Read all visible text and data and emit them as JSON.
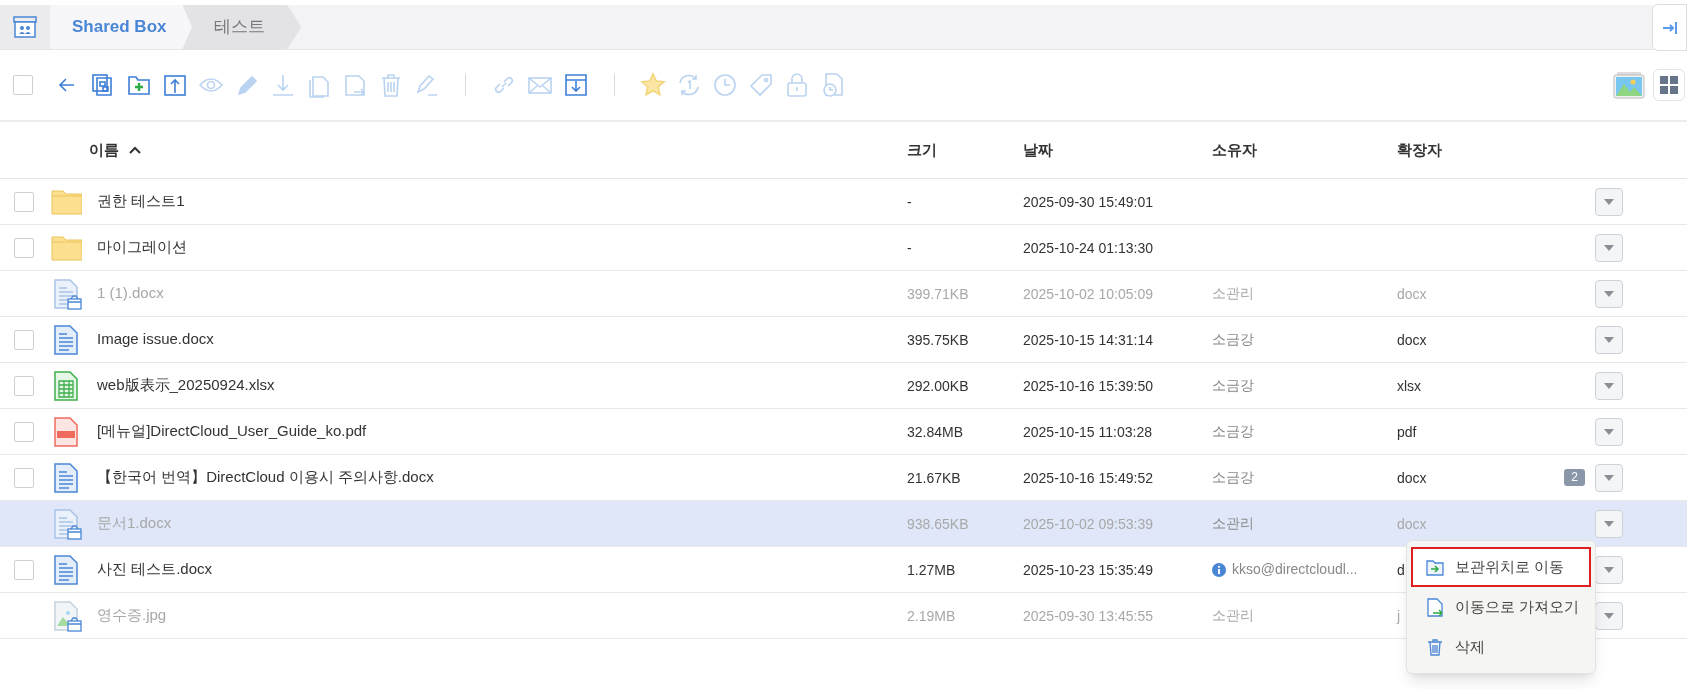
{
  "breadcrumb": [
    {
      "label": "Shared Box",
      "current": false
    },
    {
      "label": "테스트",
      "current": true
    }
  ],
  "toolbar": {
    "select_all": {
      "checked": false
    },
    "groups": [
      [
        {
          "kind": "back",
          "disabled": false
        },
        {
          "kind": "copy",
          "disabled": false
        },
        {
          "kind": "newfolder",
          "disabled": false
        },
        {
          "kind": "upload",
          "disabled": false
        },
        {
          "kind": "preview",
          "disabled": true
        },
        {
          "kind": "edit",
          "disabled": true
        },
        {
          "kind": "download",
          "disabled": true
        },
        {
          "kind": "duplicate",
          "disabled": true
        },
        {
          "kind": "move",
          "disabled": true
        },
        {
          "kind": "delete",
          "disabled": true
        },
        {
          "kind": "rename",
          "disabled": true
        }
      ],
      [
        {
          "kind": "link",
          "disabled": true
        },
        {
          "kind": "mail",
          "disabled": true
        },
        {
          "kind": "import",
          "disabled": false
        }
      ],
      [
        {
          "kind": "favorite",
          "disabled": true
        },
        {
          "kind": "sync",
          "disabled": true
        },
        {
          "kind": "history",
          "disabled": true
        },
        {
          "kind": "tag",
          "disabled": true
        },
        {
          "kind": "lock",
          "disabled": true
        },
        {
          "kind": "version",
          "disabled": true
        }
      ]
    ]
  },
  "table": {
    "columns": [
      {
        "label": "이름",
        "sort_ascending": true
      },
      {
        "label": "크기"
      },
      {
        "label": "날짜"
      },
      {
        "label": "소유자"
      },
      {
        "label": "확장자"
      }
    ],
    "rows": [
      {
        "kind": "folder",
        "name": "권한 테스트1",
        "size": "-",
        "date": "2025-09-30 15:49:01",
        "archived": false,
        "checked": false,
        "selected": false
      },
      {
        "kind": "folder",
        "name": "마이그레이션",
        "size": "-",
        "date": "2025-10-24 01:13:30",
        "archived": false,
        "checked": false,
        "selected": false
      },
      {
        "kind": "doc",
        "name": "1 (1).docx",
        "size": "399.71KB",
        "date": "2025-10-02 10:05:09",
        "owner": "소관리",
        "ext": "docx",
        "archived": true,
        "selected": false
      },
      {
        "kind": "doc",
        "name": "Image issue.docx",
        "size": "395.75KB",
        "date": "2025-10-15 14:31:14",
        "owner": "소금강",
        "ext": "docx",
        "archived": false,
        "checked": false,
        "selected": false
      },
      {
        "kind": "sheet",
        "name": "web版表示_20250924.xlsx",
        "size": "292.00KB",
        "date": "2025-10-16 15:39:50",
        "owner": "소금강",
        "ext": "xlsx",
        "archived": false,
        "checked": false,
        "selected": false
      },
      {
        "kind": "pdf",
        "name": "[메뉴얼]DirectCloud_User_Guide_ko.pdf",
        "size": "32.84MB",
        "date": "2025-10-15 11:03:28",
        "owner": "소금강",
        "ext": "pdf",
        "archived": false,
        "checked": false,
        "selected": false
      },
      {
        "kind": "doc",
        "name": "【한국어 번역】DirectCloud 이용시 주의사항.docx",
        "size": "21.67KB",
        "date": "2025-10-16 15:49:52",
        "owner": "소금강",
        "ext": "docx",
        "comments": "2",
        "archived": false,
        "checked": false,
        "selected": false
      },
      {
        "kind": "doc",
        "name": "문서1.docx",
        "size": "938.65KB",
        "date": "2025-10-02 09:53:39",
        "owner": "소관리",
        "ext": "docx",
        "archived": true,
        "selected": true
      },
      {
        "kind": "doc",
        "name": "사진 테스트.docx",
        "size": "1.27MB",
        "date": "2025-10-23 15:35:49",
        "owner": "kkso@directcloudl...",
        "owner_info": true,
        "ext": "d",
        "archived": false,
        "checked": false,
        "selected": false
      },
      {
        "kind": "image",
        "name": "영수증.jpg",
        "size": "2.19MB",
        "date": "2025-09-30 13:45:55",
        "owner": "소관리",
        "ext": "j",
        "archived": true,
        "selected": false
      }
    ]
  },
  "context_menu": {
    "items": [
      {
        "kind": "tostorage",
        "label": "보관위치로 이동",
        "selected": true
      },
      {
        "kind": "import",
        "label": "이동으로 가져오기",
        "selected": false
      },
      {
        "kind": "delete",
        "label": "삭제",
        "selected": false
      }
    ]
  }
}
